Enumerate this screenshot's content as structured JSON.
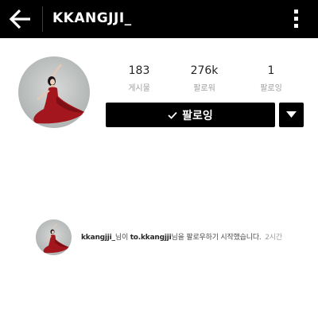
{
  "header": {
    "back_icon": "arrow-left-icon",
    "username": "KKANGJJI_",
    "more_icon": "vertical-dots-icon",
    "background": "#000000"
  },
  "profile": {
    "avatar_icon": "profile-photo",
    "stats": [
      {
        "value": "183",
        "label": "게시물"
      },
      {
        "value": "276k",
        "label": "팔로워"
      },
      {
        "value": "1",
        "label": "팔로잉"
      }
    ],
    "follow_button": {
      "icon": "check-icon",
      "label": "팔로잉"
    },
    "dropdown_icon": "caret-down-icon"
  },
  "activity": [
    {
      "avatar_icon": "profile-photo",
      "actor": "kkangjji_",
      "text_1": "님이 ",
      "target": "to.kkangjji",
      "text_2": "님을 팔로우하기 시작했습니다.",
      "time": "2시간"
    }
  ],
  "colors": {
    "accent": "#000000",
    "muted_text": "#9e9e9e",
    "dress": "#a4161e"
  }
}
